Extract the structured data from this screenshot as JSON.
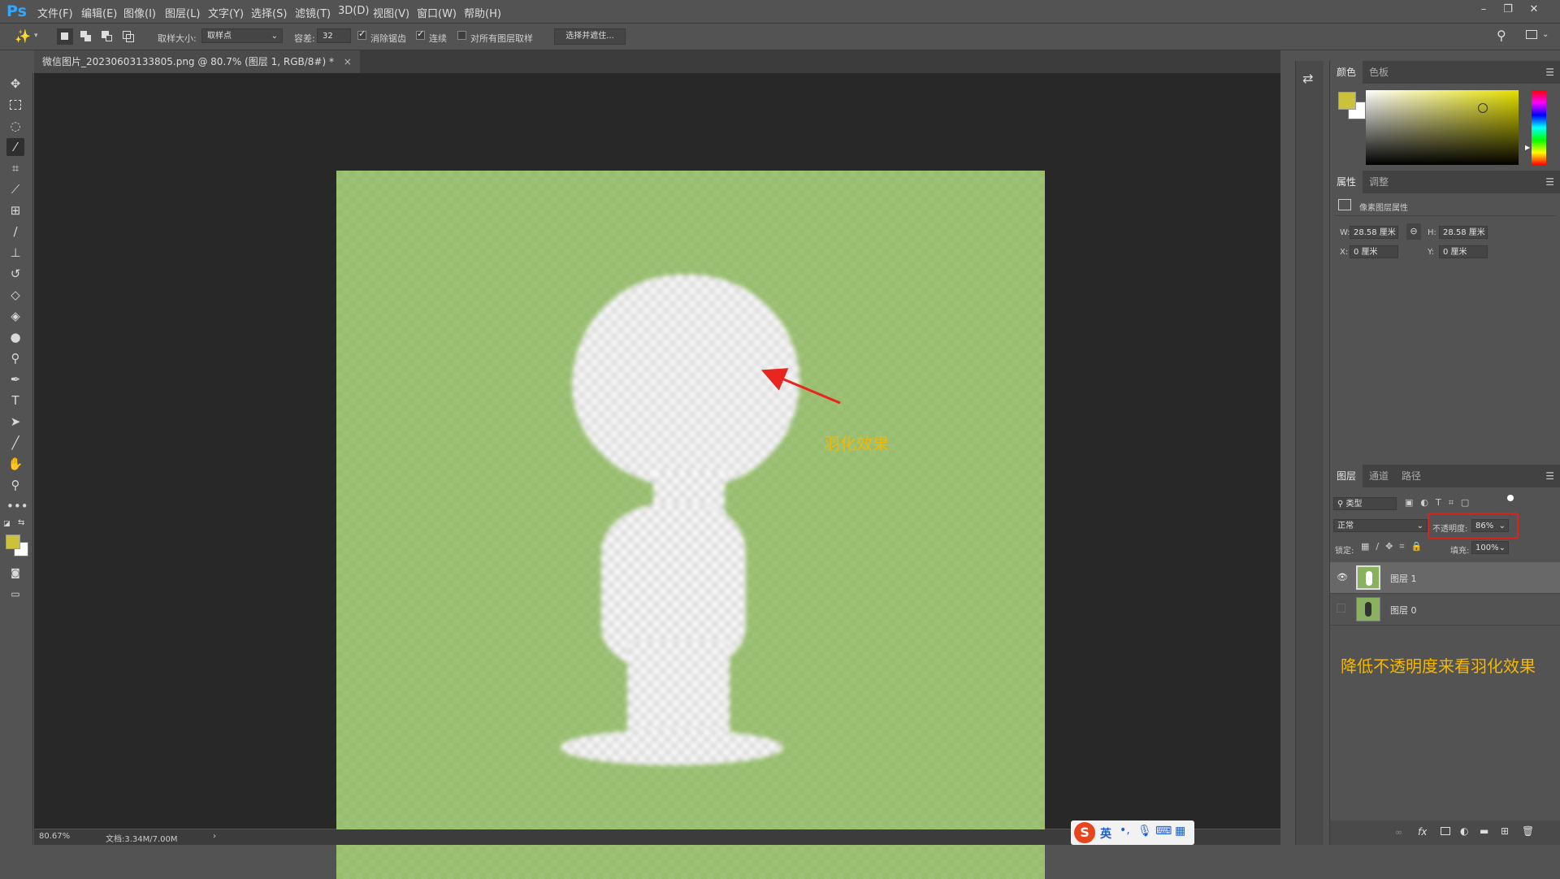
{
  "app": {
    "logo": "Ps"
  },
  "menu": [
    "文件(F)",
    "编辑(E)",
    "图像(I)",
    "图层(L)",
    "文字(Y)",
    "选择(S)",
    "滤镜(T)",
    "3D(D)",
    "视图(V)",
    "窗口(W)",
    "帮助(H)"
  ],
  "options": {
    "sample_size_label": "取样大小:",
    "sample_size_value": "取样点",
    "tolerance_label": "容差:",
    "tolerance_value": "32",
    "antialias_label": "消除锯齿",
    "antialias_checked": true,
    "contiguous_label": "连续",
    "contiguous_checked": true,
    "sample_all_label": "对所有图层取样",
    "sample_all_checked": false,
    "select_mask_button": "选择并遮住..."
  },
  "document": {
    "tab_title": "微信图片_20230603133805.png @ 80.7% (图层 1, RGB/8#) *",
    "close": "×"
  },
  "status": {
    "zoom": "80.67%",
    "doc_info": "文档:3.34M/7.00M",
    "arrow": "›"
  },
  "annotations": {
    "feather_effect": "羽化效果",
    "lower_opacity": "降低不透明度来看羽化效果"
  },
  "color_panel": {
    "tabs": [
      "颜色",
      "色板"
    ],
    "foreground": "#c9c23a",
    "background": "#ffffff"
  },
  "properties_panel": {
    "tabs": [
      "属性",
      "调整"
    ],
    "title": "像素图层属性",
    "w_label": "W:",
    "w_value": "28.58 厘米",
    "h_label": "H:",
    "h_value": "28.58 厘米",
    "x_label": "X:",
    "x_value": "0 厘米",
    "y_label": "Y:",
    "y_value": "0 厘米"
  },
  "layers_panel": {
    "tabs": [
      "图层",
      "通道",
      "路径"
    ],
    "filter_kind": "类型",
    "blend_mode": "正常",
    "opacity_label": "不透明度:",
    "opacity_value": "86%",
    "lock_label": "锁定:",
    "fill_label": "填充:",
    "fill_value": "100%",
    "layers": [
      {
        "name": "图层 1",
        "visible": true,
        "selected": true
      },
      {
        "name": "图层 0",
        "visible": false,
        "selected": false
      }
    ],
    "footer_icons": [
      "link-icon",
      "fx-icon",
      "mask-icon",
      "adjustment-icon",
      "group-icon",
      "new-layer-icon",
      "trash-icon"
    ],
    "footer_fx": "fx"
  },
  "ime": {
    "logo": "S",
    "lang": "英"
  },
  "icons": {
    "tools": [
      "move-icon",
      "marquee-icon",
      "lasso-icon",
      "magic-wand-icon",
      "crop-icon",
      "eyedropper-icon",
      "healing-icon",
      "brush-icon",
      "stamp-icon",
      "history-brush-icon",
      "eraser-icon",
      "paint-bucket-icon",
      "blur-icon",
      "dodge-icon",
      "pen-icon",
      "type-icon",
      "path-select-icon",
      "line-icon",
      "hand-icon",
      "zoom-icon",
      "more-icon"
    ]
  }
}
